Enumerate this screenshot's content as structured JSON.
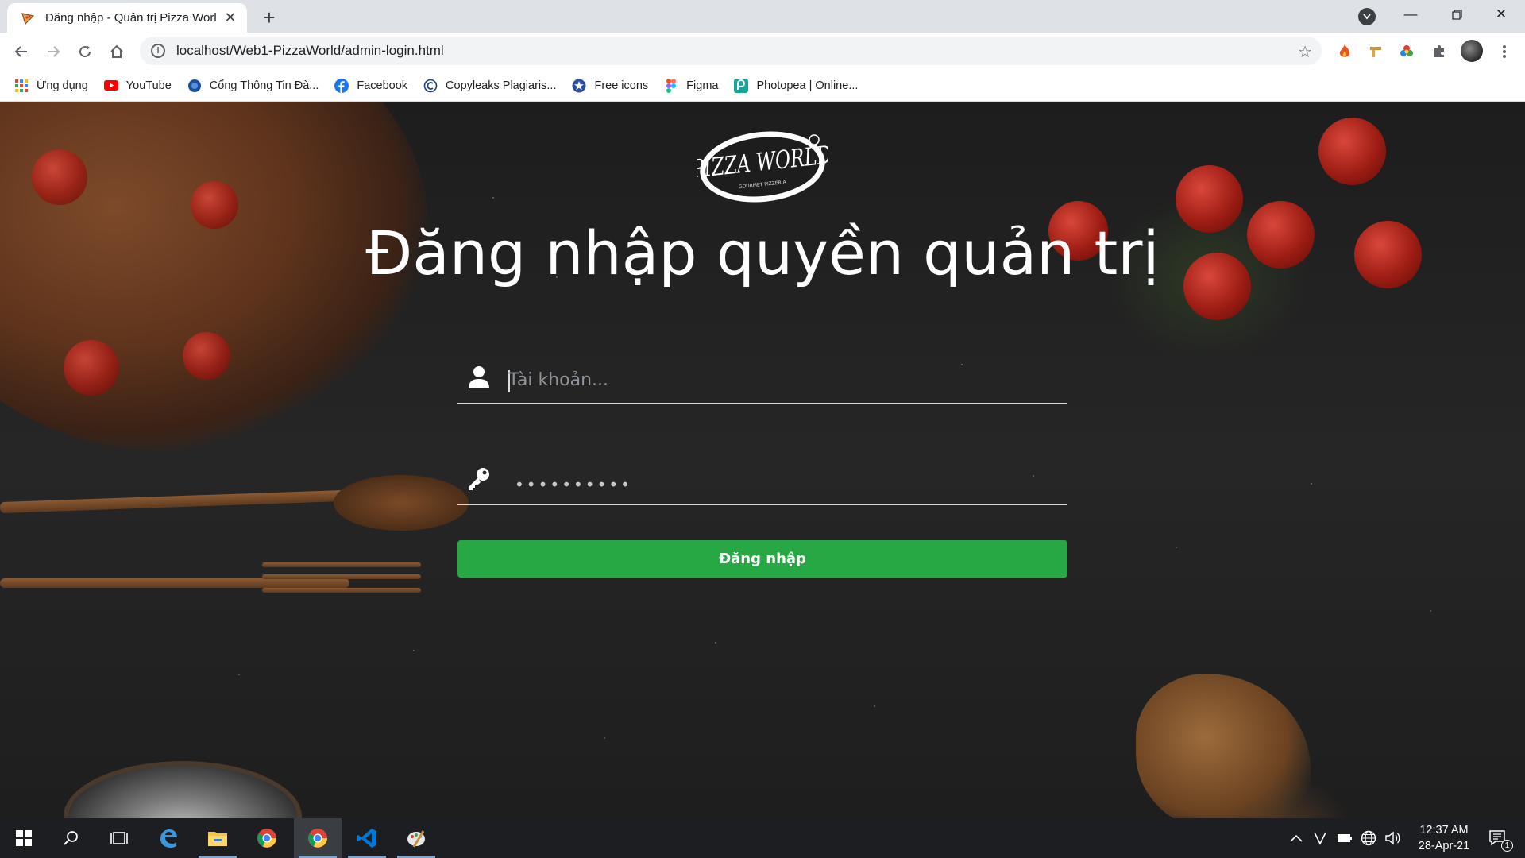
{
  "browser": {
    "tab_title": "Đăng nhập - Quản trị Pizza World",
    "url": "localhost/Web1-PizzaWorld/admin-login.html"
  },
  "bookmarks": [
    {
      "label": "Ứng dụng",
      "icon": "apps-grid-icon"
    },
    {
      "label": "YouTube",
      "icon": "youtube-icon"
    },
    {
      "label": "Cổng Thông Tin Đà...",
      "icon": "portal-icon"
    },
    {
      "label": "Facebook",
      "icon": "facebook-icon"
    },
    {
      "label": "Copyleaks Plagiaris...",
      "icon": "copyleaks-icon"
    },
    {
      "label": "Free icons",
      "icon": "free-icons-icon"
    },
    {
      "label": "Figma",
      "icon": "figma-icon"
    },
    {
      "label": "Photopea | Online...",
      "icon": "photopea-icon"
    }
  ],
  "page": {
    "logo_text": "PIZZA WORLD",
    "logo_subtext": "GOURMET PIZZERIA",
    "title": "Đăng nhập quyền quản trị",
    "username_placeholder": "Tài khoản...",
    "password_mask": "••••••••••",
    "login_button": "Đăng nhập"
  },
  "taskbar": {
    "time": "12:37 AM",
    "date": "28-Apr-21",
    "notification_count": "1"
  },
  "colors": {
    "button_green": "#28a745",
    "page_bg": "#1e1e1e",
    "tab_strip": "#dee1e6"
  }
}
